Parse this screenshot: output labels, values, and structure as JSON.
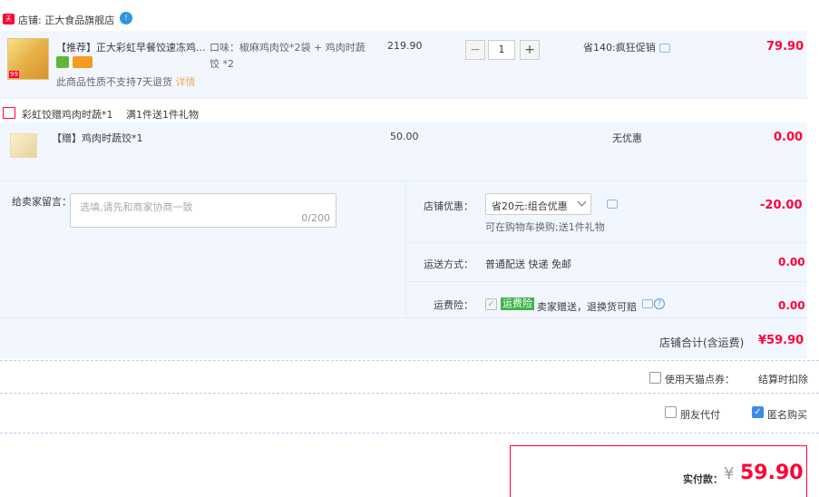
{
  "shop": {
    "badge_text": "天猫",
    "label": "店铺: 正大食品旗舰店",
    "ww_icon_text": "!"
  },
  "product": {
    "thumb_corner": "99",
    "title": "【推荐】正大彩虹早餐饺速冻鸡...",
    "attr": "口味：椒麻鸡肉饺*2袋 + 鸡肉时蔬饺 *2",
    "notice": "此商品性质不支持7天退货",
    "notice_link": "详情",
    "unit_price": "219.90",
    "qty_minus": "−",
    "qty_value": "1",
    "qty_plus": "+",
    "discount_text": "省140:疯狂促销",
    "subtotal": "79.90"
  },
  "gift_promo": {
    "gift_icon": "gift-icon",
    "left_text": "彩虹饺赠鸡肉时蔬*1",
    "right_text": "满1件送1件礼物"
  },
  "gift_item": {
    "title": "【赠】鸡肉时蔬饺*1",
    "unit_price": "50.00",
    "discount_text": "无优惠",
    "subtotal": "0.00"
  },
  "message": {
    "label": "给卖家留言：",
    "placeholder": "选填,请先和商家协商一致",
    "counter": "0/200"
  },
  "shop_discount": {
    "label": "店铺优惠：",
    "selected": "省20元:组合优惠",
    "hint": "可在购物车换购;送1件礼物",
    "amount": "-20.00"
  },
  "shipping": {
    "label": "运送方式：",
    "value": "普通配送 快递 免邮",
    "amount": "0.00"
  },
  "insurance": {
    "label": "运费险：",
    "tag": "运费险",
    "value": "卖家赠送，退换货可赔",
    "amount": "0.00"
  },
  "shop_total": {
    "label": "店铺合计(含运费)",
    "amount": "¥59.90"
  },
  "points": {
    "label": "使用天猫点券：",
    "right_text": "结算时扣除"
  },
  "options": {
    "friend_pay": "朋友代付",
    "anonymous": "匿名购买"
  },
  "pay": {
    "label": "实付款：",
    "currency": "¥",
    "amount": "59.90"
  },
  "colors": {
    "accent_red": "#ff0036",
    "section_bg": "#f2f7ff",
    "blue_check": "#3c8ce7",
    "green_tag": "#3db349"
  }
}
